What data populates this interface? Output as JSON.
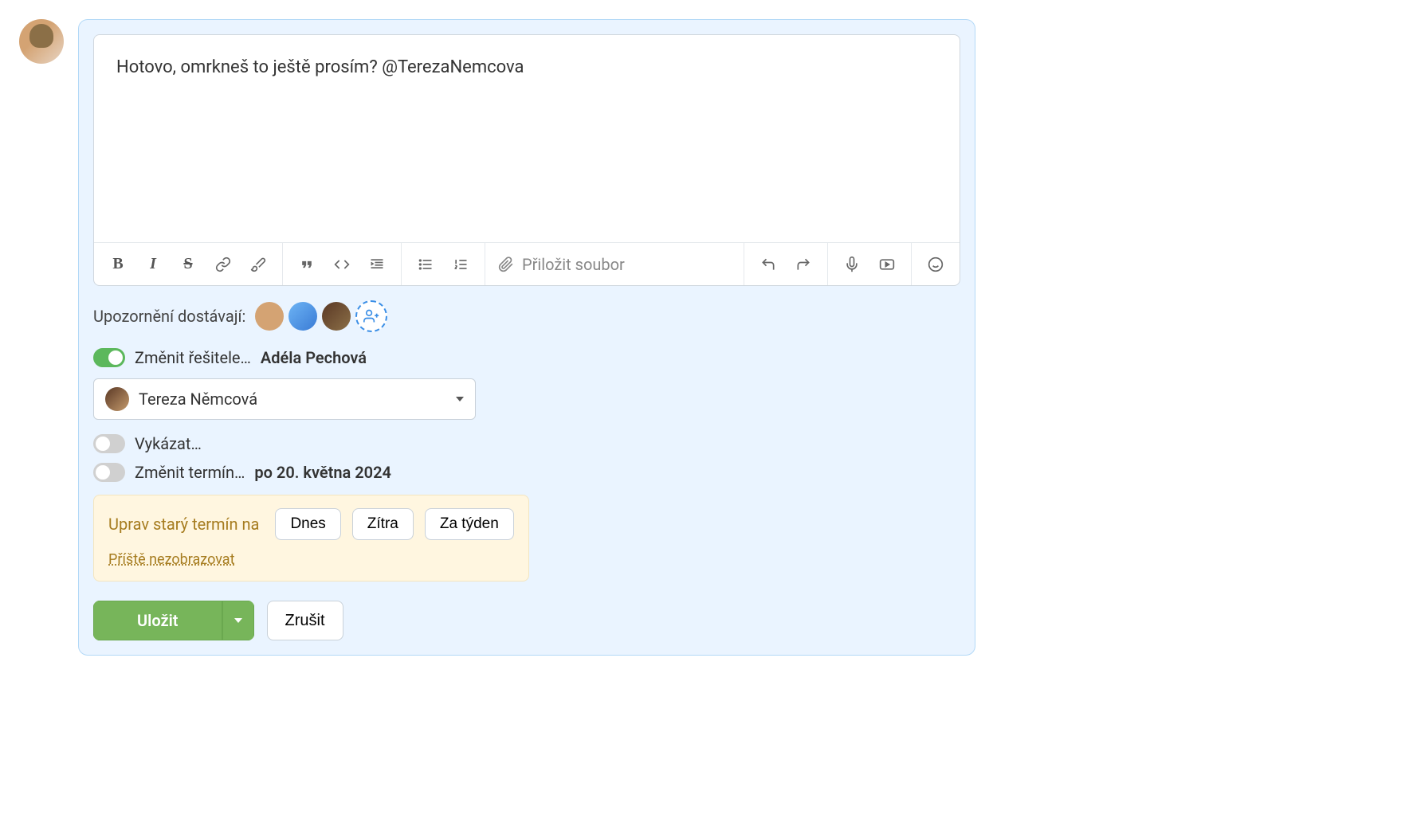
{
  "editor": {
    "content": "Hotovo, omrkneš to ještě prosím? @TerezaNemcova",
    "attach_label": "Přiložit soubor"
  },
  "toolbar_icons": {
    "bold": "B",
    "italic": "I",
    "strike": "S",
    "link": "link",
    "brush": "brush",
    "quote": "\"\"",
    "code": "<>",
    "indent": "indent",
    "ul": "ul",
    "ol": "ol",
    "undo": "undo",
    "redo": "redo",
    "mic": "mic",
    "video": "video",
    "emoji": "emoji"
  },
  "notify": {
    "label": "Upozornění dostávají:"
  },
  "assignee": {
    "label": "Změnit řešitele…",
    "name": "Adéla Pechová",
    "selected": "Tereza Němcová"
  },
  "track": {
    "label": "Vykázat…"
  },
  "deadline": {
    "label": "Změnit termín…",
    "date": "po 20. května 2024"
  },
  "suggest": {
    "label": "Uprav starý termín na",
    "options": [
      "Dnes",
      "Zítra",
      "Za týden"
    ],
    "dismiss": "Příště nezobrazovat"
  },
  "actions": {
    "save": "Uložit",
    "cancel": "Zrušit"
  }
}
